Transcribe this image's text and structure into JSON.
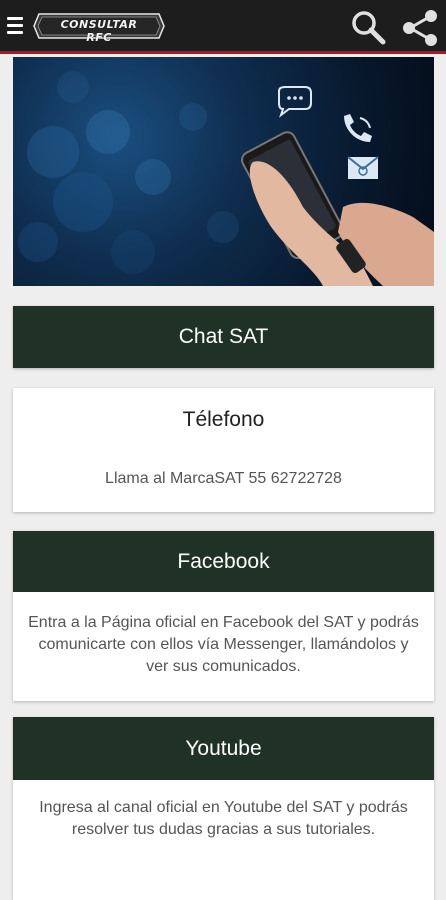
{
  "app": {
    "logo_text": "CONSULTAR RFC"
  },
  "icons": {
    "menu": "hamburger-icon",
    "search": "search-icon",
    "share": "share-icon"
  },
  "colors": {
    "topbar": "#1d1d1d",
    "accent": "#c0101a",
    "card_header": "#203226",
    "background": "#eeeeee"
  },
  "cards": {
    "chat": {
      "title": "Chat SAT"
    },
    "telefono": {
      "title": "Télefono",
      "text": "Llama al MarcaSAT 55 62722728"
    },
    "facebook": {
      "title": "Facebook",
      "text": "Entra a la Página oficial en Facebook del SAT y podrás comunicarte con ellos vía Messenger, llamándolos y ver sus comunicados."
    },
    "youtube": {
      "title": "Youtube",
      "text": "Ingresa al canal oficial en Youtube del SAT y podrás resolver tus dudas gracias a sus tutoriales."
    }
  }
}
